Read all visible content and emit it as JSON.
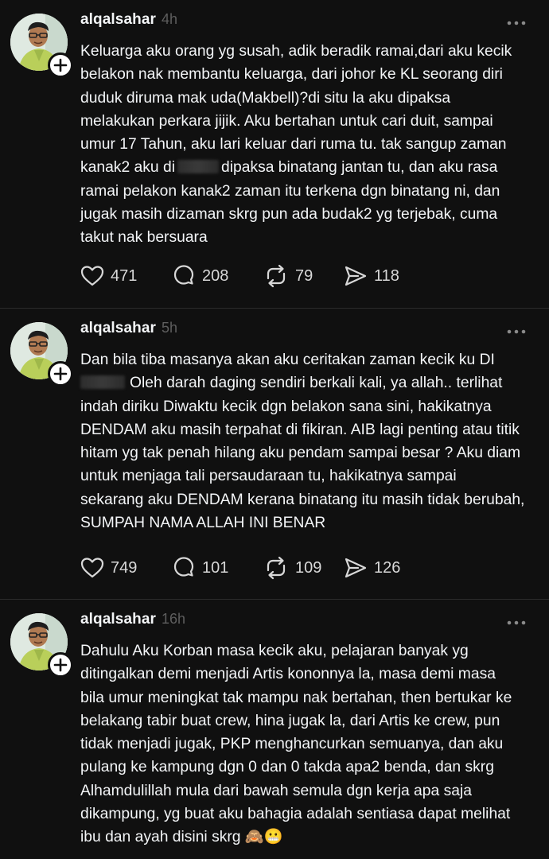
{
  "posts": [
    {
      "username": "alqalsahar",
      "timestamp": "4h",
      "lines": [
        "Keluarga aku orang yg susah, adik beradik ramai,dari aku kecik",
        "belakon nak membantu keluarga, dari johor ke KL seorang diri",
        "duduk diruma mak uda(Makbell)?di situ la aku dipaksa",
        "melakukan perkara jijik. Aku bertahan untuk cari duit, sampai",
        "umur 17 Tahun, aku lari keluar dari ruma tu. tak sangup zaman",
        "kanak2 aku di",
        "dipaksa binatang jantan tu, dan aku rasa",
        "ramai pelakon kanak2 zaman itu terkena dgn binatang ni, dan",
        "jugak masih dizaman skrg pun ada budak2 yg terjebak, cuma",
        "takut nak bersuara"
      ],
      "likes": "471",
      "replies": "208",
      "reposts": "79",
      "shares": "118"
    },
    {
      "username": "alqalsahar",
      "timestamp": "5h",
      "lines": [
        "Dan bila tiba masanya akan aku ceritakan zaman kecik ku DI",
        "Oleh darah daging sendiri berkali kali, ya allah.. terlihat",
        "indah diriku Diwaktu kecik dgn belakon sana sini, hakikatnya",
        "DENDAM aku masih terpahat di fikiran. AIB lagi penting atau titik",
        "hitam yg tak penah hilang aku pendam sampai besar ? Aku diam",
        "untuk menjaga tali persaudaraan tu, hakikatnya sampai",
        "sekarang aku DENDAM kerana binatang itu masih tidak berubah,",
        "SUMPAH NAMA ALLAH INI BENAR"
      ],
      "likes": "749",
      "replies": "101",
      "reposts": "109",
      "shares": "126"
    },
    {
      "username": "alqalsahar",
      "timestamp": "16h",
      "lines": [
        "Dahulu Aku Korban masa kecik aku, pelajaran banyak yg",
        "ditingalkan demi menjadi Artis kononnya la, masa demi masa",
        "bila umur meningkat tak mampu nak bertahan, then bertukar ke",
        "belakang tabir buat crew, hina jugak la, dari Artis ke crew, pun",
        "tidak menjadi jugak, PKP menghancurkan semuanya, dan aku",
        "pulang ke kampung dgn 0 dan 0 takda apa2 benda, dan skrg",
        "Alhamdulillah mula dari bawah semula dgn kerja apa saja",
        "dikampung, yg buat aku bahagia adalah sentiasa dapat melihat",
        "ibu dan ayah disini skrg"
      ],
      "emojis": [
        "🙈",
        "😬"
      ]
    }
  ],
  "icons": {
    "like": "heart-icon",
    "reply": "comment-bubble-icon",
    "repost": "repost-arrows-icon",
    "share": "send-arrow-icon",
    "more": "more-horizontal-icon",
    "follow": "plus-icon"
  },
  "colors": {
    "background": "#101010",
    "text": "#f3f5f7",
    "muted": "#5e5e5e",
    "divider": "#2b2b2b"
  }
}
